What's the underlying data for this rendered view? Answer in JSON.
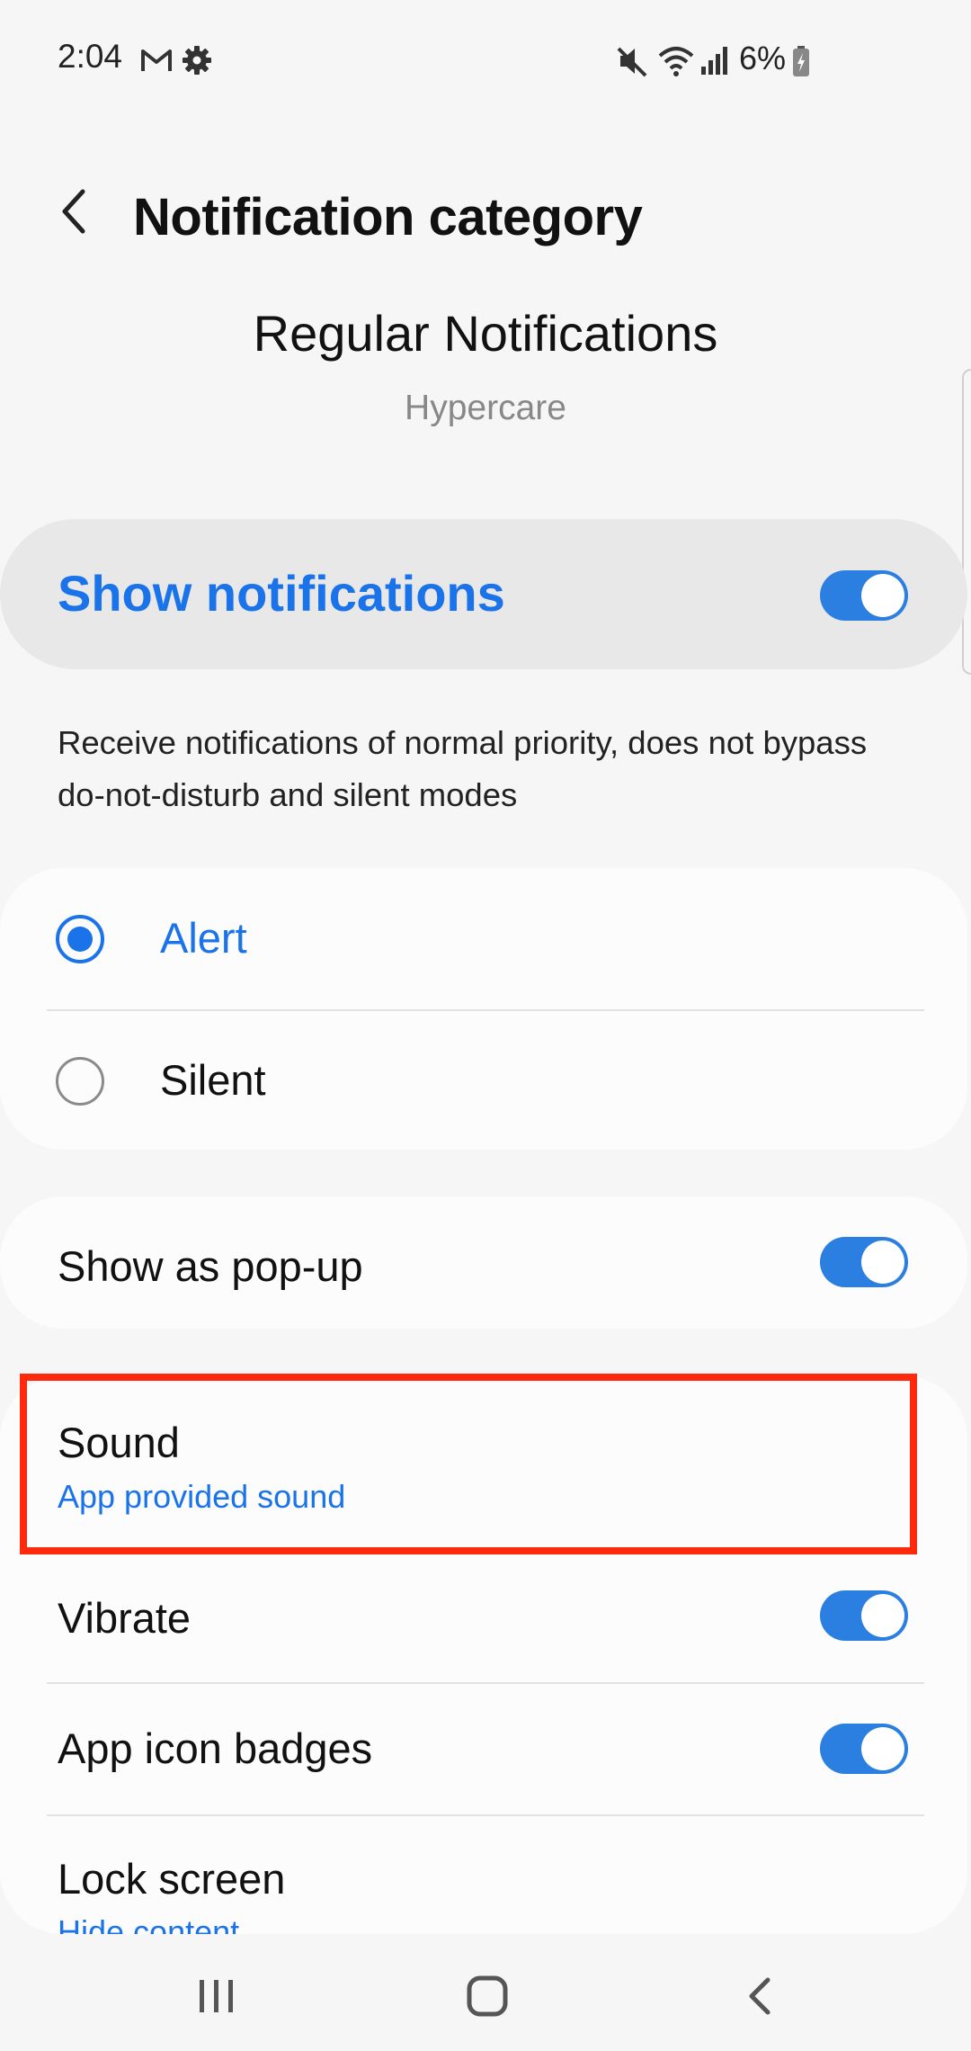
{
  "status_bar": {
    "time": "2:04",
    "battery_percent": "6%",
    "icons": [
      "gmail-icon",
      "settings-gear-icon",
      "mute-icon",
      "wifi-icon",
      "signal-icon",
      "battery-charging-icon"
    ]
  },
  "header": {
    "title": "Notification category"
  },
  "category": {
    "name": "Regular Notifications",
    "app_name": "Hypercare"
  },
  "show_notifications": {
    "label": "Show notifications",
    "enabled": true
  },
  "description": "Receive notifications of normal priority, does not bypass do-not-disturb and silent modes",
  "alert_mode": {
    "options": [
      {
        "label": "Alert",
        "selected": true
      },
      {
        "label": "Silent",
        "selected": false
      }
    ]
  },
  "settings": {
    "popup": {
      "label": "Show as pop-up",
      "enabled": true
    },
    "sound": {
      "label": "Sound",
      "value": "App provided sound"
    },
    "vibrate": {
      "label": "Vibrate",
      "enabled": true
    },
    "badges": {
      "label": "App icon badges",
      "enabled": true
    },
    "lock_screen": {
      "label": "Lock screen",
      "value": "Hide content"
    }
  },
  "colors": {
    "accent": "#1a73e8",
    "toggle_on": "#2b7fe0",
    "highlight_box": "#ff2a0c"
  }
}
